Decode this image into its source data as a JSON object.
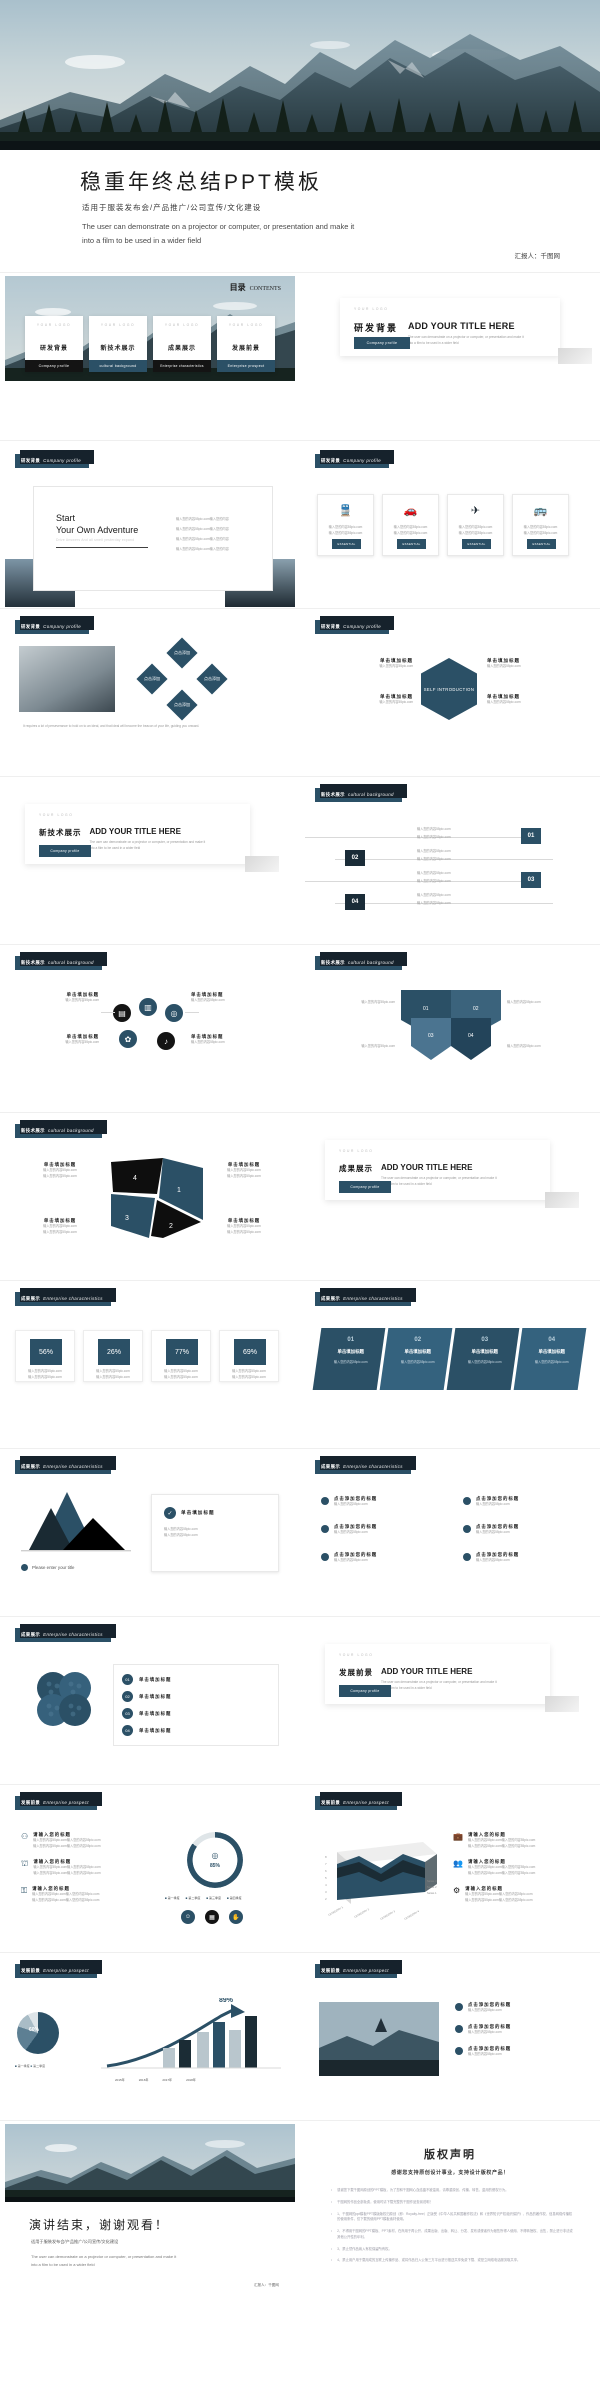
{
  "cover": {
    "title": "稳重年终总结PPT模板",
    "subtitle_cn": "适用于服装发布会/产品推广/公司宣传/文化建设",
    "subtitle_en_line1": "The user can demonstrate  on a projector or computer, or presentation  and make it",
    "subtitle_en_line2": "into a film  to be used in a wider  field",
    "author": "汇报人：千图网"
  },
  "contents": {
    "title_cn": "目录",
    "title_en": "CONTENTS",
    "logo": "YOUR LOGO",
    "items": [
      {
        "cn": "研发背景",
        "en": "Company profile",
        "style": "dark"
      },
      {
        "cn": "新技术展示",
        "en": "cultural background",
        "style": "blue"
      },
      {
        "cn": "成果展示",
        "en": "Enterprise characteristics",
        "style": "dark"
      },
      {
        "cn": "发展前景",
        "en": "Enterprise prospect",
        "style": "blue"
      }
    ]
  },
  "sections": [
    {
      "cn": "研发背景",
      "en": "Company profile"
    },
    {
      "cn": "新技术展示",
      "en": "cultural background"
    },
    {
      "cn": "成果展示",
      "en": "Enterprise characteristics"
    },
    {
      "cn": "发展前景",
      "en": "Enterprise prospect"
    }
  ],
  "section_slides": [
    {
      "logo": "YOUR LOGO",
      "cn": "研发背景",
      "en_title": "ADD YOUR TITLE HERE",
      "desc": "The user can demonstrate  on a projector or computer, or presentation and make it into a film to be used in a wider field",
      "button": "Company profile"
    },
    {
      "logo": "YOUR LOGO",
      "cn": "新技术展示",
      "en_title": "ADD YOUR TITLE HERE",
      "desc": "The user can demonstrate  on a projector or computer, or presentation and make it into a film to be used in a wider field",
      "button": "Company profile"
    },
    {
      "logo": "YOUR LOGO",
      "cn": "成果展示",
      "en_title": "ADD YOUR TITLE HERE",
      "desc": "The user can demonstrate  on a projector or computer, or presentation and make it into a film to be used in a wider field",
      "button": "Company profile"
    },
    {
      "logo": "YOUR LOGO",
      "cn": "发展前景",
      "en_title": "ADD YOUR TITLE HERE",
      "desc": "The user can demonstrate  on a projector or computer, or presentation and make it into a film to be used in a wider field",
      "button": "Company profile"
    }
  ],
  "adventure": {
    "line1": "Start",
    "line2": "Your Own Adventure",
    "sub": "Drive Answers And all smell yesterday expand",
    "bullets": [
      "输入您的内容55pic.com输入您的内容",
      "输入您的内容55pic.com输入您的内容",
      "输入您的内容55pic.com输入您的内容",
      "输入您的内容55pic.com输入您的内容"
    ]
  },
  "icon_cards": {
    "items": [
      {
        "icon": "train-icon",
        "glyph": "🚄",
        "l1": "输入您的内容55pic.com",
        "l2": "输入您的内容55pic.com",
        "badge": "ESSENTIAL"
      },
      {
        "icon": "car-icon",
        "glyph": "🚗",
        "l1": "输入您的内容55pic.com",
        "l2": "输入您的内容55pic.com",
        "badge": "ESSENTIAL"
      },
      {
        "icon": "plane-icon",
        "glyph": "✈",
        "l1": "输入您的内容55pic.com",
        "l2": "输入您的内容55pic.com",
        "badge": "ESSENTIAL"
      },
      {
        "icon": "bus-icon",
        "glyph": "🚌",
        "l1": "输入您的内容55pic.com",
        "l2": "输入您的内容55pic.com",
        "badge": "ESSENTIAL"
      }
    ]
  },
  "diamond_slide": {
    "caption": "It requires a lot of perseverance to hold on to an ideal, and that ideal will become the beacon of your life, guiding you onward.",
    "diamonds": [
      "点击添加",
      "点击添加",
      "点击添加",
      "点击添加"
    ]
  },
  "hexagon_slide": {
    "center": "SELF INTRODUCTION",
    "items": [
      {
        "t": "单击填加标题",
        "d": "输入您的内容55pic.com"
      },
      {
        "t": "单击填加标题",
        "d": "输入您的内容55pic.com"
      },
      {
        "t": "单击填加标题",
        "d": "输入您的内容55pic.com"
      },
      {
        "t": "单击填加标题",
        "d": "输入您的内容55pic.com"
      }
    ]
  },
  "numbered_list": {
    "rows": [
      {
        "num": "01",
        "l1": "输入您的内容55pic.com",
        "l2": "输入您的内容55pic.com"
      },
      {
        "num": "02",
        "l1": "输入您的内容55pic.com",
        "l2": "输入您的内容55pic.com"
      },
      {
        "num": "03",
        "l1": "输入您的内容55pic.com",
        "l2": "输入您的内容55pic.com"
      },
      {
        "num": "04",
        "l1": "输入您的内容55pic.com",
        "l2": "输入您的内容55pic.com"
      }
    ]
  },
  "circle_icons": {
    "items": [
      {
        "t": "单击填加标题",
        "d": "输入您的内容55pic.com",
        "icon": "doc-icon",
        "glyph": "▤"
      },
      {
        "t": "单击填加标题",
        "d": "输入您的内容55pic.com",
        "icon": "chart-icon",
        "glyph": "▥"
      },
      {
        "t": "单击填加标题",
        "d": "输入您的内容55pic.com",
        "icon": "bulb-icon",
        "glyph": "◎"
      },
      {
        "t": "单击填加标题",
        "d": "输入您的内容55pic.com",
        "icon": "gear-icon",
        "glyph": "✿"
      },
      {
        "t": "单击填加标题",
        "d": "输入您的内容55pic.com",
        "icon": "mic-icon",
        "glyph": "♪"
      }
    ]
  },
  "arrow_flow": {
    "nums": [
      "01",
      "02",
      "03",
      "04"
    ],
    "texts": [
      "输入您的内容55pic.com",
      "输入您的内容55pic.com",
      "输入您的内容55pic.com",
      "输入您的内容55pic.com"
    ]
  },
  "pinwheel": {
    "nums": [
      "1",
      "2",
      "3",
      "4"
    ],
    "items": [
      {
        "t": "单击填加标题",
        "d1": "输入您的内容55pic.com",
        "d2": "输入您的内容55pic.com"
      },
      {
        "t": "单击填加标题",
        "d1": "输入您的内容55pic.com",
        "d2": "输入您的内容55pic.com"
      },
      {
        "t": "单击填加标题",
        "d1": "输入您的内容55pic.com",
        "d2": "输入您的内容55pic.com"
      },
      {
        "t": "单击填加标题",
        "d1": "输入您的内容55pic.com",
        "d2": "输入您的内容55pic.com"
      }
    ]
  },
  "stats": {
    "cards": [
      {
        "value": "56%",
        "l1": "输入您的内容55pic.com",
        "l2": "输入您的内容55pic.com"
      },
      {
        "value": "26%",
        "l1": "输入您的内容55pic.com",
        "l2": "输入您的内容55pic.com"
      },
      {
        "value": "77%",
        "l1": "输入您的内容55pic.com",
        "l2": "输入您的内容55pic.com"
      },
      {
        "value": "69%",
        "l1": "输入您的内容55pic.com",
        "l2": "输入您的内容55pic.com"
      }
    ]
  },
  "ribbon_stats": {
    "cards": [
      {
        "num": "01",
        "t": "单击填加标题",
        "d": "输入您的内容55pic.com"
      },
      {
        "num": "02",
        "t": "单击填加标题",
        "d": "输入您的内容55pic.com"
      },
      {
        "num": "03",
        "t": "单击填加标题",
        "d": "输入您的内容55pic.com"
      },
      {
        "num": "04",
        "t": "单击填加标题",
        "d": "输入您的内容55pic.com"
      }
    ]
  },
  "mountain_slide": {
    "placeholder": "Please enter your title",
    "card_title": "单击填加标题",
    "d1": "输入您的内容55pic.com",
    "d2": "输入您的内容55pic.com"
  },
  "bullet_grid": {
    "items": [
      "点击添加您的标题",
      "点击添加您的标题",
      "点击添加您的标题",
      "点击添加您的标题",
      "点击添加您的标题",
      "点击添加您的标题"
    ],
    "desc": "输入您的内容55pic.com"
  },
  "clover": {
    "items": [
      {
        "n": "01",
        "t": "单击填加标题"
      },
      {
        "n": "02",
        "t": "单击填加标题"
      },
      {
        "n": "03",
        "t": "单击填加标题"
      },
      {
        "n": "04",
        "t": "单击填加标题"
      }
    ]
  },
  "donut_slide": {
    "value": "85%",
    "legend": [
      "第一季度",
      "第二季度",
      "第三季度",
      "第四季度"
    ],
    "items": [
      {
        "t": "请输入您的标题",
        "d1": "输入您的内容55pic.com输入您的内容55pic.com",
        "d2": "输入您的内容55pic.com输入您的内容55pic.com",
        "icon": "people-icon"
      },
      {
        "t": "请输入您的标题",
        "d1": "输入您的内容55pic.com输入您的内容55pic.com",
        "d2": "输入您的内容55pic.com输入您的内容55pic.com",
        "icon": "bank-icon"
      },
      {
        "t": "请输入您的标题",
        "d1": "输入您的内容55pic.com输入您的内容55pic.com",
        "d2": "输入您的内容55pic.com输入您的内容55pic.com",
        "icon": "lock-icon"
      }
    ]
  },
  "area3d_slide": {
    "axis_labels": [
      "CATEGORY 1",
      "CATEGORY 2",
      "CATEGORY 3",
      "CATEGORY 4"
    ],
    "series": [
      "Series 1",
      "Series 2",
      "Series 3"
    ],
    "items": [
      {
        "t": "请输入您的标题",
        "d1": "输入您的内容55pic.com输入您的内容55pic.com",
        "d2": "输入您的内容55pic.com输入您的内容55pic.com",
        "icon": "briefcase-icon"
      },
      {
        "t": "请输入您的标题",
        "d1": "输入您的内容55pic.com输入您的内容55pic.com",
        "d2": "输入您的内容55pic.com输入您的内容55pic.com",
        "icon": "team-icon"
      },
      {
        "t": "请输入您的标题",
        "d1": "输入您的内容55pic.com输入您的内容55pic.com",
        "d2": "输入您的内容55pic.com输入您的内容55pic.com",
        "icon": "gear-icon"
      }
    ]
  },
  "growth_slide": {
    "peak": "89%",
    "pie_label": "60%",
    "legend": [
      "第一季度",
      "第二季度",
      "第三季度"
    ],
    "axis": [
      "2015年",
      "2016年",
      "2017年",
      "2018年"
    ]
  },
  "photo_list": {
    "items": [
      {
        "t": "点击添加您的标题",
        "d": "输入您的内容55pic.com"
      },
      {
        "t": "点击添加您的标题",
        "d": "输入您的内容55pic.com"
      },
      {
        "t": "点击添加您的标题",
        "d": "输入您的内容55pic.com"
      }
    ]
  },
  "end": {
    "title": "演讲结束，谢谢观看！",
    "subtitle_cn": "适用于服装发布会/产品推广/公司宣传/文化建设",
    "subtitle_en_line1": "The user can demonstrate  on a projector or computer, or presentation and make it",
    "subtitle_en_line2": "into a film  to be used in a wider field",
    "author": "汇报人：千图网"
  },
  "copyright": {
    "title": "版权声明",
    "subtitle": "感谢您支持原创设计事业，支持设计版权产品！",
    "items": [
      "感谢您下载千图网原创的PPT模板，为了您和千图网心血结晶不被滥用，请尊重原创、传播、转售、盗用的侵权行为。",
      "千图网的作品全部免费，使用时请下载完整的千图作品查阅说明！",
      "1、千图网的ppt模板PPT模版版权归原创（即：Royalty-free）正版受《中华人民共和国著作权法》和《世界知识产权组织保护》、作品的著作权、信息网络传播权的使用条件，仅下载的使用PPT模板素材使用。",
      "2、不得用千图网的PPT模板、PPT素材，在商用于再公开、成果出版、出版、转让、分发、发布或侵者作为贩售所得人使用、不得转授权、出售，禁止进行非法或其他公开性的牟利。",
      "3、禁止然作品纳入有权保留所有权。",
      "4、禁止用户用于载用成的互联上传播作品、或将作品归入公第三方平台进行推送共享免费下载、或是立网络电话服务取共享。"
    ]
  }
}
